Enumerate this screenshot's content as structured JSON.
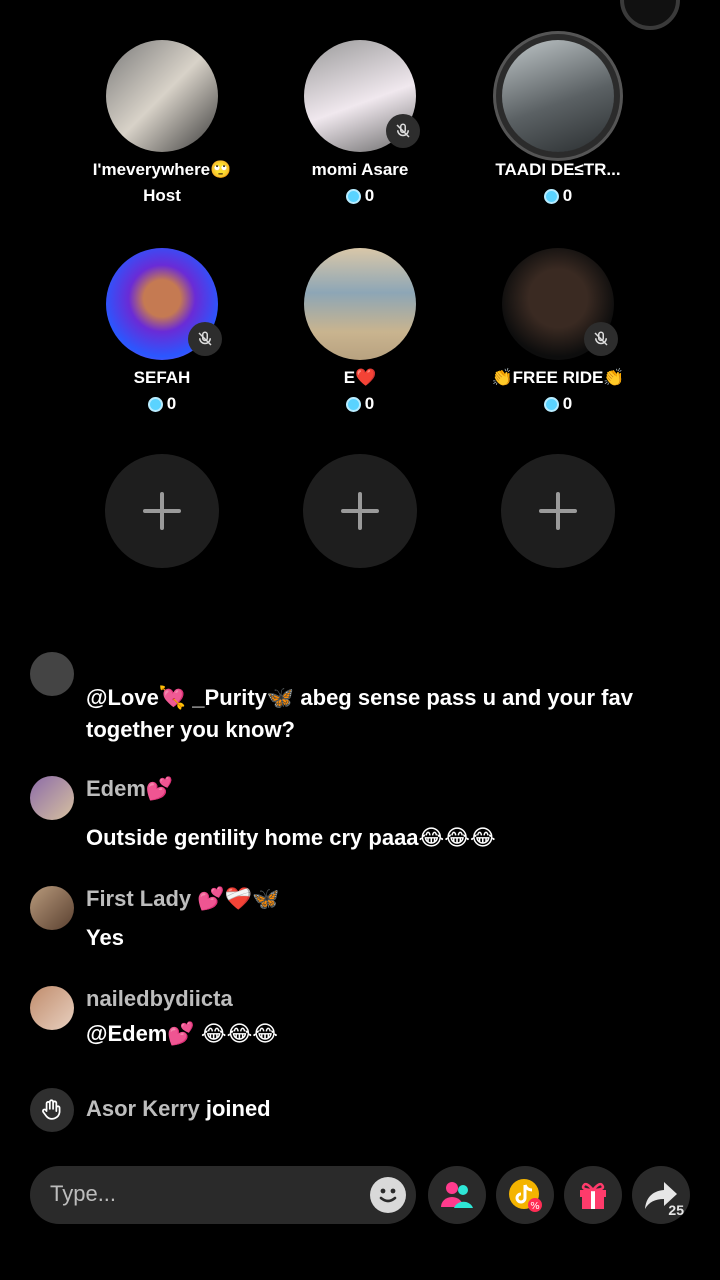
{
  "seats": [
    {
      "name": "I'meverywhere🙄",
      "sub": "Host",
      "muted": false,
      "ring": false
    },
    {
      "name": "momi Asare",
      "coins": "0",
      "muted": true,
      "ring": false
    },
    {
      "name": "TAADI DE≤TR...",
      "coins": "0",
      "muted": false,
      "ring": true
    },
    {
      "name": "SEFAH",
      "coins": "0",
      "muted": true,
      "ring": false
    },
    {
      "name": "E❤️",
      "coins": "0",
      "muted": false,
      "ring": false
    },
    {
      "name": "👏FREE RIDE👏",
      "coins": "0",
      "muted": true,
      "ring": false
    }
  ],
  "empty_seats": [
    "+",
    "+",
    "+"
  ],
  "chat": [
    {
      "user": "",
      "text": "@Love💘 _Purity🦋 abeg sense pass u and your fav together you know?"
    },
    {
      "user": "Edem💕",
      "text": "Outside gentility home cry paaa😂😂😂"
    },
    {
      "user": "First Lady 💕❤️‍🩹🦋",
      "text": "Yes"
    },
    {
      "user": "nailedbydiicta",
      "text": "@Edem💕 😂😂😂"
    }
  ],
  "join_notice": {
    "user": "Asor Kerry",
    "action": "joined"
  },
  "input": {
    "placeholder": "Type..."
  },
  "share_count": "25",
  "colors": {
    "background": "#000000",
    "panel": "#2a2a2a",
    "coin": "#5ad3ff",
    "gift": "#ff3b6b",
    "users": "#2ee6d6"
  }
}
